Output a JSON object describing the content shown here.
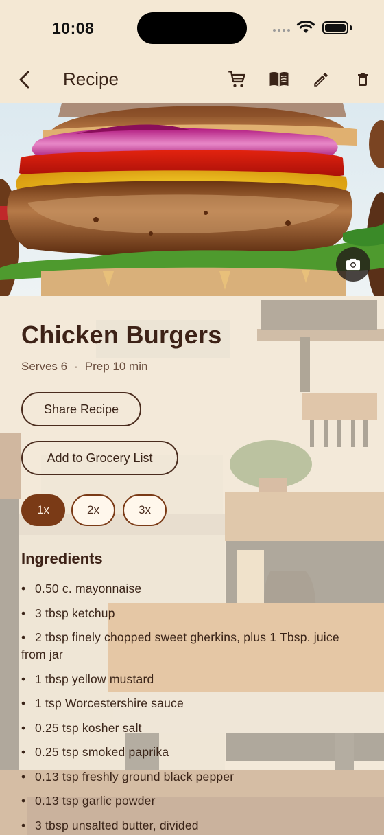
{
  "status_bar": {
    "time": "10:08"
  },
  "app_bar": {
    "title": "Recipe"
  },
  "recipe": {
    "title": "Chicken Burgers",
    "serves": "Serves 6",
    "separator": "·",
    "prep": "Prep 10 min"
  },
  "actions": {
    "share_label": "Share Recipe",
    "grocery_label": "Add to Grocery List"
  },
  "scale_options": [
    {
      "label": "1x",
      "selected": true
    },
    {
      "label": "2x",
      "selected": false
    },
    {
      "label": "3x",
      "selected": false
    }
  ],
  "ingredients_heading": "Ingredients",
  "bullet": "•",
  "ingredients": [
    "0.50 c. mayonnaise",
    "3 tbsp ketchup",
    "2 tbsp finely chopped sweet gherkins, plus 1 Tbsp. juice from jar",
    "1 tbsp yellow mustard",
    "1 tsp Worcestershire sauce",
    "0.25 tsp kosher salt",
    "0.25 tsp smoked paprika",
    "0.13 tsp freshly ground black pepper",
    "0.13 tsp garlic powder",
    "3 tbsp unsalted butter, divided"
  ],
  "icons": {
    "back": "chevron-left-icon",
    "cart": "shopping-cart-icon",
    "book": "open-book-icon",
    "edit": "pencil-icon",
    "delete": "trash-icon",
    "camera": "camera-icon"
  },
  "colors": {
    "background": "#f4e8d4",
    "accent": "#7a3a16",
    "text": "#3a2418"
  }
}
